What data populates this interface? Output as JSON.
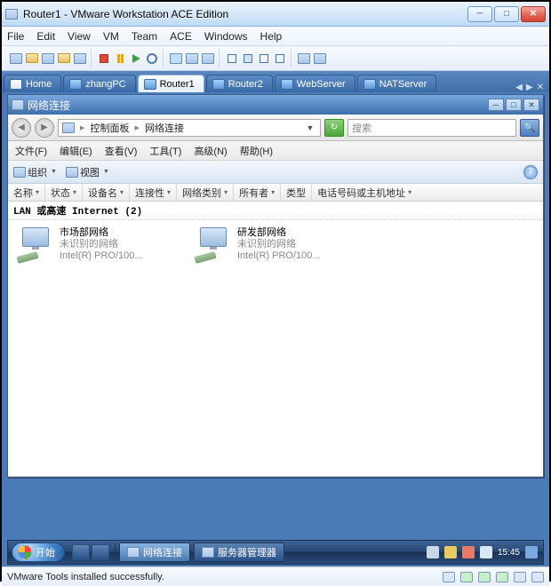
{
  "vmware": {
    "title": "Router1 - VMware Workstation ACE Edition",
    "menu": [
      "File",
      "Edit",
      "View",
      "VM",
      "Team",
      "ACE",
      "Windows",
      "Help"
    ],
    "status": "VMware Tools installed successfully."
  },
  "tabs": [
    {
      "label": "Home",
      "active": false,
      "home": true
    },
    {
      "label": "zhangPC",
      "active": false
    },
    {
      "label": "Router1",
      "active": true
    },
    {
      "label": "Router2",
      "active": false
    },
    {
      "label": "WebServer",
      "active": false
    },
    {
      "label": "NATServer",
      "active": false
    }
  ],
  "inner": {
    "title": "网络连接",
    "breadcrumb_root": "控制面板",
    "breadcrumb_leaf": "网络连接",
    "search_placeholder": "搜索",
    "menu": [
      "文件(F)",
      "编辑(E)",
      "查看(V)",
      "工具(T)",
      "高级(N)",
      "帮助(H)"
    ],
    "tool_org": "组织",
    "tool_view": "视图",
    "cols": [
      "名称",
      "状态",
      "设备名",
      "连接性",
      "网络类别",
      "所有者",
      "类型",
      "电话号码或主机地址"
    ],
    "group": "LAN 或高速 Internet (2)",
    "items": [
      {
        "name": "市场部网络",
        "status": "未识别的网络",
        "device": "Intel(R) PRO/100..."
      },
      {
        "name": "研发部网络",
        "status": "未识别的网络",
        "device": "Intel(R) PRO/100..."
      }
    ]
  },
  "taskbar": {
    "start": "开始",
    "apps": [
      {
        "label": "网络连接",
        "active": true
      },
      {
        "label": "服务器管理器",
        "active": false
      }
    ],
    "clock": "15:45"
  }
}
